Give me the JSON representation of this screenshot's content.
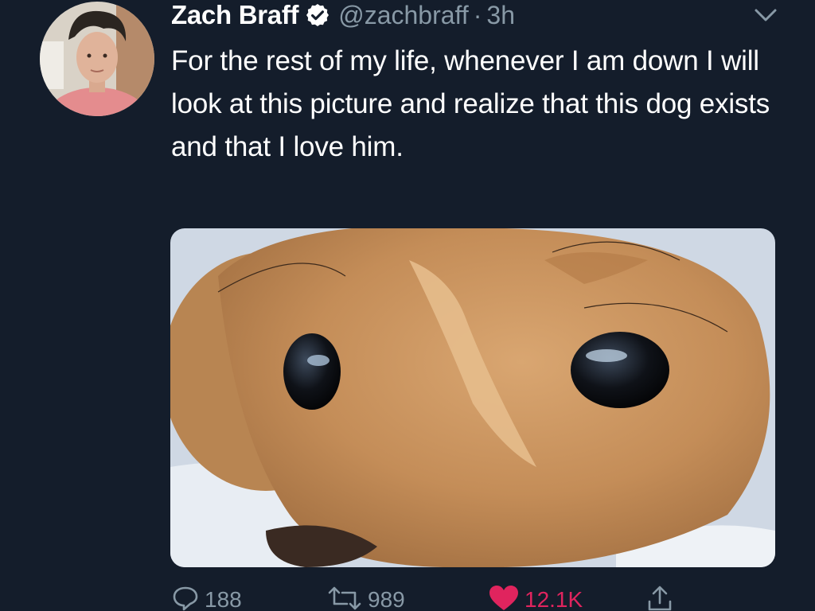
{
  "tweet": {
    "author": {
      "name": "Zach Braff",
      "handle": "@zachbraff",
      "verified": true
    },
    "separator": "·",
    "timestamp": "3h",
    "text": "For the rest of my life, whenever I am down I will look at this picture and realize that this dog exists and that I love him.",
    "media": {
      "description": "close-up photo of a tan puppy"
    },
    "actions": {
      "reply_count": "188",
      "retweet_count": "989",
      "like_count": "12.1K",
      "liked": true
    }
  },
  "colors": {
    "background": "#141d2b",
    "text_primary": "#ffffff",
    "text_secondary": "#8899a6",
    "verified_badge": "#ffffff",
    "like_active": "#e0245e"
  },
  "icons": {
    "verified": "verified-badge-icon",
    "menu": "chevron-down-icon",
    "reply": "comment-icon",
    "retweet": "retweet-icon",
    "like": "heart-icon",
    "share": "share-icon"
  }
}
